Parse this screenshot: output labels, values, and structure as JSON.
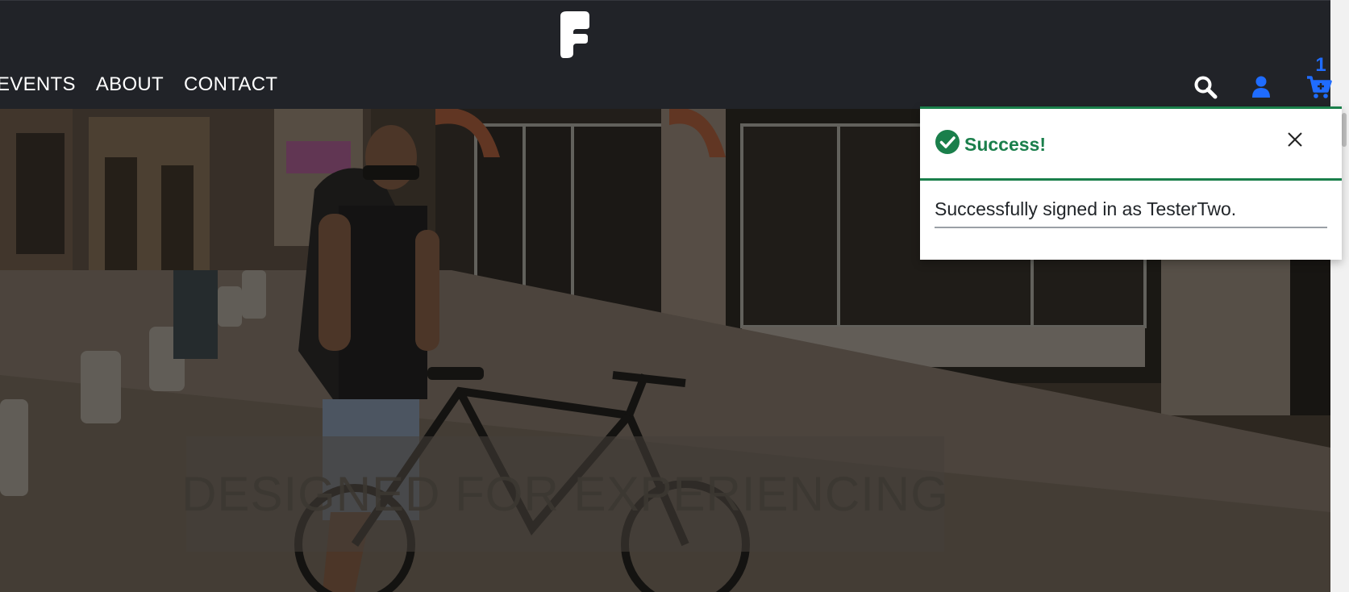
{
  "header": {
    "logo_icon": "brand-f-logo-icon",
    "nav": [
      "EVENTS",
      "ABOUT",
      "CONTACT"
    ],
    "icons": {
      "search": "search-icon",
      "account": "user-icon",
      "cart": "cart-icon"
    },
    "cart_count": "1",
    "accent_color": "#1f6cff"
  },
  "hero": {
    "caption": "DESIGNED FOR EXPERIENCING"
  },
  "toast": {
    "title": "Success!",
    "message": "Successfully signed in as TesterTwo.",
    "status_color": "#1a7f4b",
    "icon": "check-circle-icon",
    "close_icon": "close-icon"
  }
}
